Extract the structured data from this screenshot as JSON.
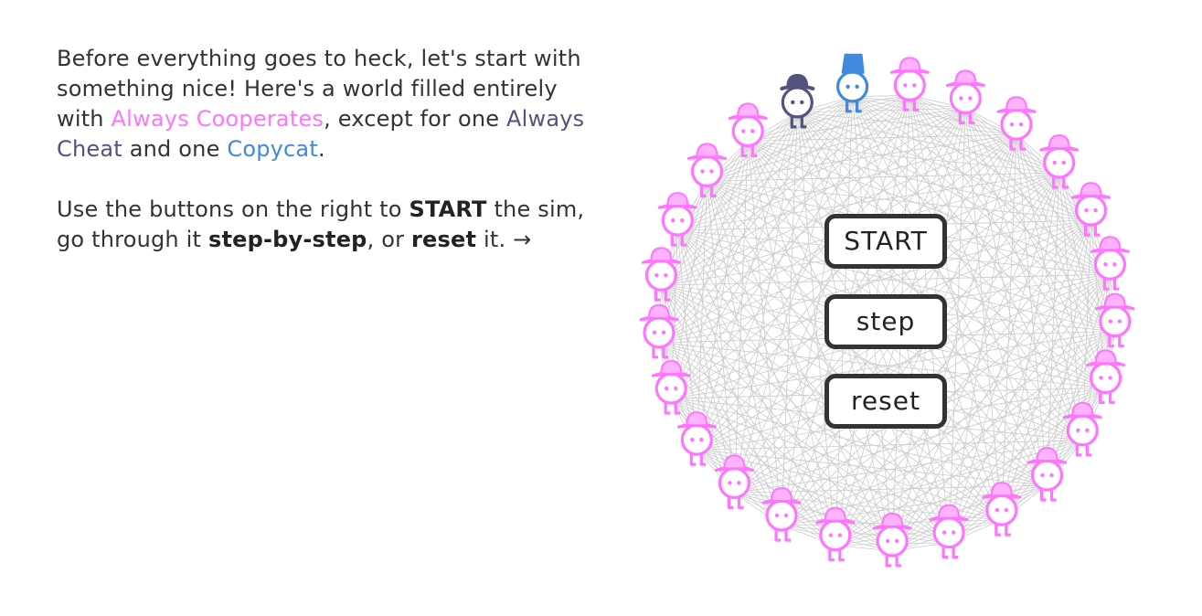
{
  "intro": {
    "p1": {
      "part1": "Before everything goes to heck, let's start with something nice! Here's a world filled entirely with ",
      "coop": "Always Cooperates",
      "part2": ", except for one ",
      "cheat": "Always Cheat",
      "part3": " and one ",
      "copycat": "Copycat",
      "part4": "."
    },
    "p2": {
      "part1": "Use the buttons on the right to ",
      "start": "START",
      "part2": " the sim, go through it ",
      "step": "step-by-step",
      "part3": ", or ",
      "reset": "reset",
      "part4": " it. →"
    }
  },
  "sim": {
    "buttons": {
      "start": "START",
      "step": "step",
      "reset": "reset"
    },
    "population": {
      "always_cooperate": 23,
      "always_cheat": 1,
      "copycat": 1
    },
    "colors": {
      "always_cooperate": "#FF75FF",
      "always_cheat": "#52537F",
      "copycat": "#4089DD",
      "connection_lines": "#CCCCCC"
    }
  }
}
